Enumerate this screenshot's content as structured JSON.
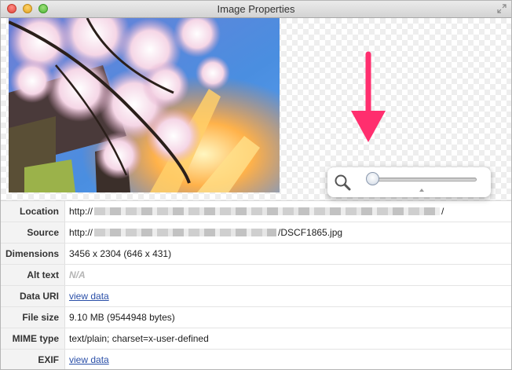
{
  "window": {
    "title": "Image Properties"
  },
  "zoom": {
    "level_fraction": 0.02
  },
  "properties": [
    {
      "key": "location",
      "label": "Location",
      "prefix": "http://",
      "suffix": "/"
    },
    {
      "key": "source",
      "label": "Source",
      "prefix": "http://",
      "suffix": "/DSCF1865.jpg"
    },
    {
      "key": "dimensions",
      "label": "Dimensions",
      "value": "3456 x 2304 (646 x 431)"
    },
    {
      "key": "alt",
      "label": "Alt text",
      "value": "N/A"
    },
    {
      "key": "datauri",
      "label": "Data URI",
      "value": "view data"
    },
    {
      "key": "filesize",
      "label": "File size",
      "value": "9.10 MB (9544948 bytes)"
    },
    {
      "key": "mime",
      "label": "MIME type",
      "value": "text/plain; charset=x-user-defined"
    },
    {
      "key": "exif",
      "label": "EXIF",
      "value": "view data"
    }
  ],
  "colors": {
    "link": "#2a4fa8",
    "annotation_arrow": "#ff2e6e"
  },
  "icons": {
    "zoom": "magnifier-icon",
    "fullscreen": "fullscreen-icon"
  }
}
